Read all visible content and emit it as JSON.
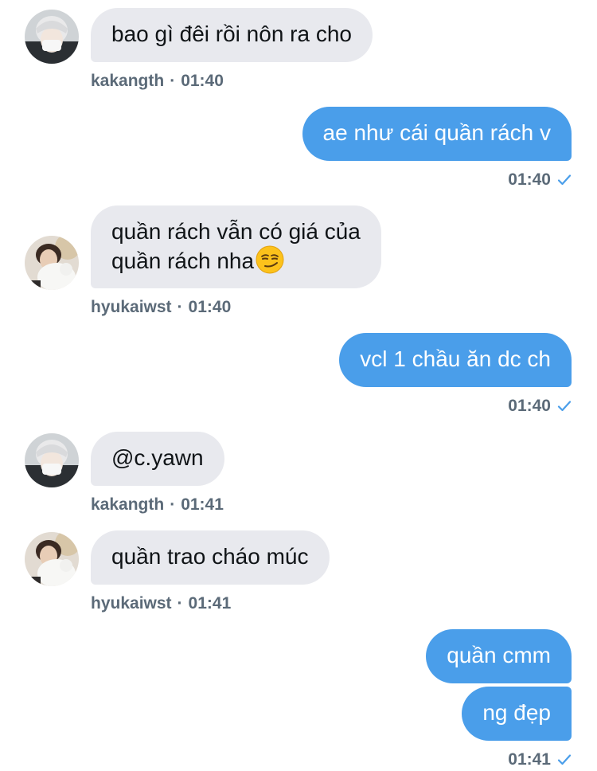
{
  "conversation": {
    "messages": [
      {
        "direction": "incoming",
        "user": "kakangth",
        "text": "bao gì đêi rồi nôn ra cho",
        "time": "01:40"
      },
      {
        "direction": "outgoing",
        "text": "ae như cái quần rách v",
        "time": "01:40"
      },
      {
        "direction": "incoming",
        "user": "hyukaiwst",
        "line1": "quần rách vẫn có giá của",
        "line2": "quần rách nha",
        "emoji": "smirking-face",
        "time": "01:40"
      },
      {
        "direction": "outgoing",
        "text": "vcl 1 chầu ăn dc ch",
        "time": "01:40"
      },
      {
        "direction": "incoming",
        "user": "kakangth",
        "text": "@c.yawn",
        "time": "01:41"
      },
      {
        "direction": "incoming",
        "user": "hyukaiwst",
        "text": "quần trao cháo múc",
        "time": "01:41"
      },
      {
        "direction": "outgoing",
        "text": "quần cmm"
      },
      {
        "direction": "outgoing",
        "text": "ng đẹp",
        "time": "01:41"
      }
    ],
    "separator": "·",
    "colors": {
      "outgoing_bubble": "#4a9eea",
      "incoming_bubble": "#e8e9ee",
      "meta_text": "#5b6a78",
      "read_check": "#4a9eea"
    },
    "icons": {
      "read_receipt": "checkmark-icon"
    }
  }
}
